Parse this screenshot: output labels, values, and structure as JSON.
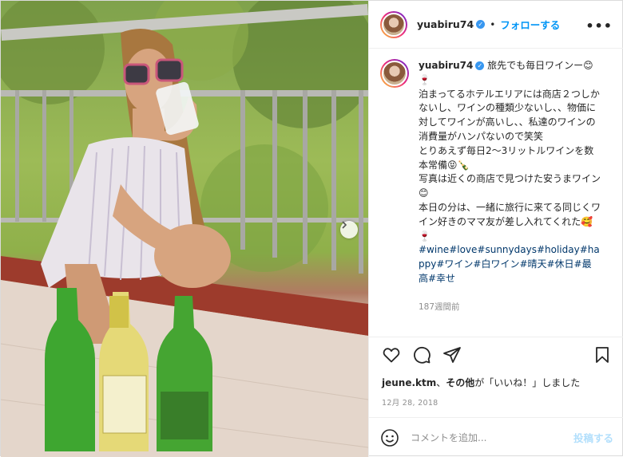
{
  "post": {
    "username": "yuabiru74",
    "follow_label": "フォローする",
    "separator": "•",
    "more_label": "•••",
    "caption_user": "yuabiru74",
    "caption_text": "旅先でも毎日ワインー😊🍷\n泊まってるホテルエリアには商店２つしかないし、ワインの種類少ないし、、物価に対してワインが高いし、、私達のワインの消費量がハンパないので笑笑\nとりあえず毎日2〜3リットルワインを数本常備😝🍾\n写真は近くの商店で見つけた安うまワイン😊\n本日の分は、一緒に旅行に来てる同じくワイン好きのママ友が差し入れてくれた🥰🍷",
    "hashtags": "#wine#love#sunnydays#holiday#happy#ワイン#白ワイン#晴天#休日#最高#幸せ",
    "time_ago": "187週間前",
    "likes_user": "jeune.ktm",
    "likes_rest_1": "、",
    "likes_others": "その他",
    "likes_rest_2": "が「いいね！」しました",
    "date": "12月 28, 2018",
    "comment_placeholder": "コメントを追加...",
    "post_button": "投稿する"
  },
  "icons": {
    "verified": "verified-badge-icon",
    "heart": "heart-icon",
    "comment": "comment-icon",
    "share": "share-icon",
    "save": "bookmark-icon",
    "emoji": "emoji-icon",
    "next": "chevron-right-icon"
  },
  "colors": {
    "link_blue": "#0095f6",
    "hashtag": "#00376b",
    "muted": "#8e8e8e",
    "post_disabled": "#b2dffc"
  }
}
